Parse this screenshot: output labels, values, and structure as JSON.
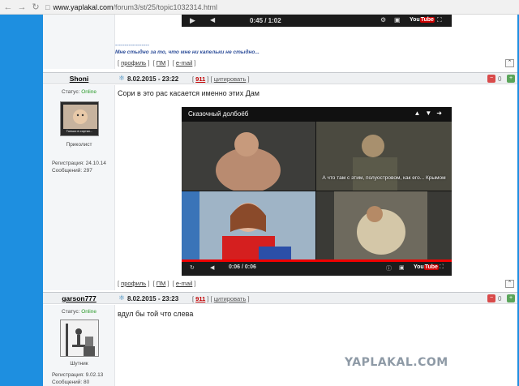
{
  "browser": {
    "url_host": "www.yaplakal.com",
    "url_path": "/forum3/st/25/topic1032314.html"
  },
  "prev_post": {
    "player_time": "0:45 / 1:02",
    "signature_dashes": "------------------",
    "signature": "Мне стыдно за то, что мне ни капельки не стыдно...",
    "footer": {
      "profile": "профиль",
      "pm": "ПМ",
      "email": "e-mail"
    }
  },
  "post1": {
    "username": "Shoni",
    "date": "8.02.2015 - 23:22",
    "number": "911",
    "quote": "цитировать",
    "rating": "0",
    "status_label": "Статус:",
    "status_value": "Online",
    "rank": "Приколист",
    "reg_label": "Регистрация: 24.10.14",
    "msgs_label": "Сообщений: 297",
    "text": "Сори в это рас касается именно этих Дам",
    "avatar_caption": "Только в сортах...",
    "video": {
      "title": "Сказочный долбоёб",
      "subtitle": "А что там с этим, полуостровом, как его... Крымом",
      "time": "0:06 / 0:06",
      "logo_you": "You",
      "logo_tube": "Tube"
    },
    "footer": {
      "profile": "профиль",
      "pm": "ПМ",
      "email": "e-mail"
    }
  },
  "post2": {
    "username": "garson777",
    "date": "8.02.2015 - 23:23",
    "number": "911",
    "quote": "цитировать",
    "rating": "0",
    "status_label": "Статус:",
    "status_value": "Online",
    "rank": "Шутник",
    "reg_label": "Регистрация: 9.02.13",
    "msgs_label": "Сообщений: 80",
    "text": "вдул бы той что слева"
  },
  "watermark": "YAPLAKAL.COM"
}
